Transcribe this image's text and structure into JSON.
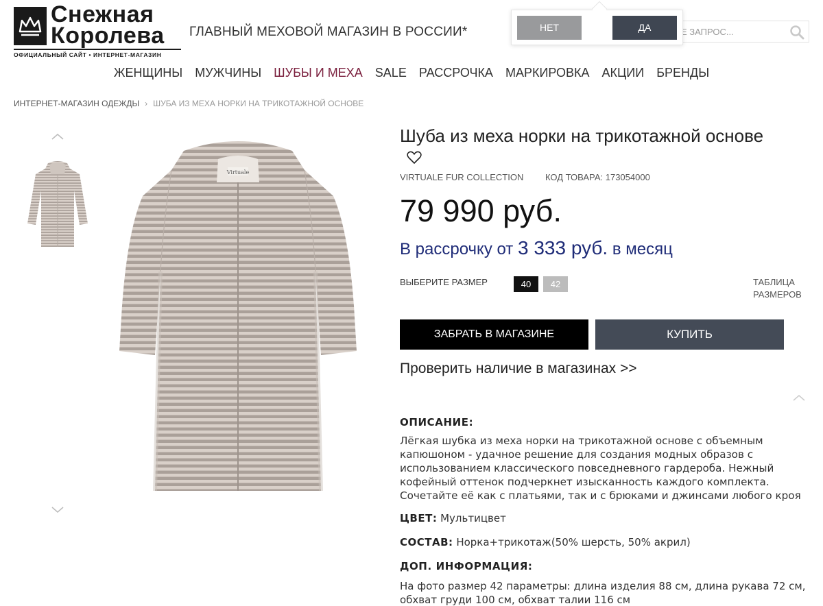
{
  "header": {
    "logo_title_line1": "Снежная",
    "logo_title_line2": "Королева",
    "logo_subtitle": "ОФИЦИАЛЬНЫЙ САЙТ • ИНТЕРНЕТ-МАГАЗИН",
    "tagline": "ГЛАВНЫЙ МЕХОВОЙ МАГАЗИН В РОССИИ*",
    "search_placeholder": "ТЕ ЗАПРОС..."
  },
  "popup": {
    "no_label": "НЕТ",
    "yes_label": "ДА"
  },
  "nav": {
    "items": [
      "ЖЕНЩИНЫ",
      "МУЖЧИНЫ",
      "ШУБЫ И МЕХА",
      "SALE",
      "РАССРОЧКА",
      "МАРКИРОВКА",
      "АКЦИИ",
      "БРЕНДЫ"
    ],
    "active_index": 2
  },
  "breadcrumb": {
    "root": "ИНТЕРНЕТ-МАГАЗИН ОДЕЖДЫ",
    "separator": "›",
    "current": "ШУБА ИЗ МЕХА НОРКИ НА ТРИКОТАЖНОЙ ОСНОВЕ"
  },
  "product": {
    "title": "Шуба из меха норки на трикотажной основе",
    "brand": "VIRTUALE FUR COLLECTION",
    "code": "КОД ТОВАРА: 173054000",
    "price": "79 990 руб.",
    "installment_prefix": "В рассрочку от ",
    "installment_amount": "3 333 руб.",
    "installment_suffix": " в месяц",
    "size_label": "ВЫБЕРИТЕ РАЗМЕР",
    "sizes": [
      "40",
      "42"
    ],
    "selected_size": "40",
    "size_table_label": "ТАБЛИЦА РАЗМЕРОВ",
    "pickup_button": "ЗАБРАТЬ В МАГАЗИНЕ",
    "buy_button": "КУПИТЬ",
    "check_stock": "Проверить наличие в магазинах >>",
    "label_on_coat": "Virtuale"
  },
  "details": {
    "description_heading": "ОПИСАНИЕ:",
    "description": "Лёгкая шубка из меха норки на трикотажной основе с объемным капюшоном - удачное решение для создания модных образов с использованием классического повседневного гардероба. Нежный кофейный оттенок подчеркнет изысканность каждого комплекта. Сочетайте её как с платьями, так и с брюками и джинсами любого кроя",
    "color_label": "ЦВЕТ:",
    "color_value": "Мультицвет",
    "composition_label": "СОСТАВ:",
    "composition_value": "Норка+трикотаж(50% шерсть, 50% акрил)",
    "extra_heading": "ДОП. ИНФОРМАЦИЯ:",
    "extra_text": "На фото размер 42 параметры: длина изделия 88 см, длина рукава 72 см, обхват груди 100 см, обхват талии 116 см"
  },
  "colors": {
    "nav_active": "#7a1f3d",
    "installment": "#1f2c78",
    "buy_button": "#444b57",
    "popup_no": "#999a9c",
    "popup_yes": "#3f4652",
    "fur_light": "#d6cdc6",
    "fur_dark": "#a79d96"
  },
  "icons": {
    "logo": "crown-icon",
    "search": "search-icon",
    "favorite": "heart-icon",
    "gallery_up": "chevron-up-icon",
    "gallery_down": "chevron-down-icon",
    "scroll_top": "chevron-up-icon"
  }
}
